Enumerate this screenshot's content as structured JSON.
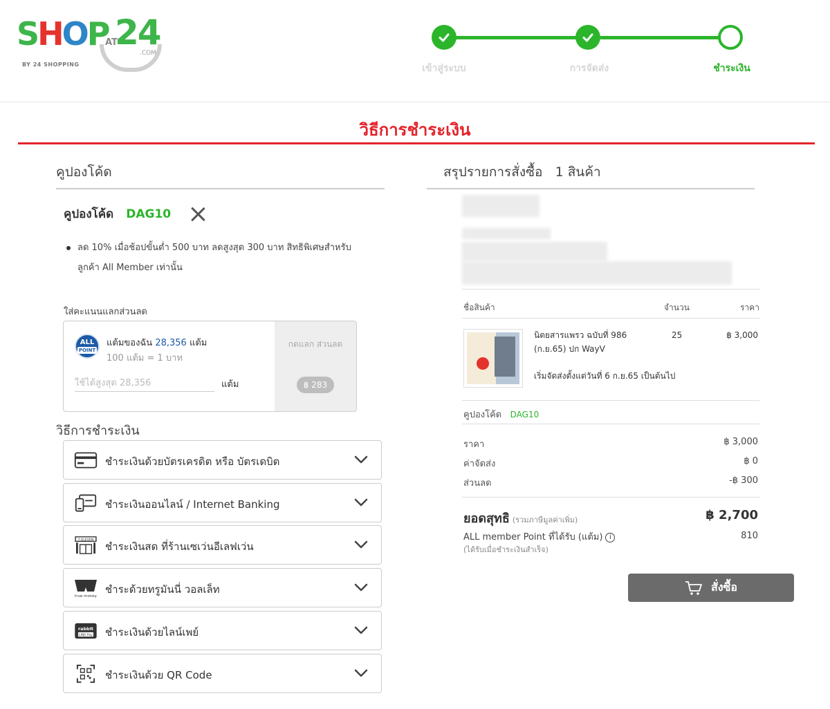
{
  "logo": {
    "shop": [
      "S",
      "H",
      "O",
      "P"
    ],
    "at": "AT",
    "num": "24",
    "com": ".COM",
    "tagline": "BY 24 SHOPPING"
  },
  "steps": [
    {
      "label": "เข้าสู่ระบบ",
      "done": true
    },
    {
      "label": "การจัดส่ง",
      "done": true
    },
    {
      "label": "ชำระเงิน",
      "done": false,
      "current": true
    }
  ],
  "page_title": "วิธีการชำระเงิน",
  "coupon": {
    "section_title": "คูปองโค้ด",
    "label": "คูปองโค้ด",
    "code": "DAG10",
    "description": "ลด 10% เมื่อช้อปขั้นต่ำ 500 บาท ลดสูงสุด 300 บาท สิทธิพิเศษสำหรับลูกค้า All Member เท่านั้น"
  },
  "points": {
    "title": "ใส่คะแนนแลกส่วนลด",
    "logo_top": "ALL",
    "logo_bottom": "POINT",
    "my_points_label": "แต้มของฉัน",
    "my_points_value": "28,356",
    "my_points_unit": "แต้ม",
    "rate": "100 แต้ม = 1 บาท",
    "input_placeholder": "ใช้ได้สูงสุด 28,356",
    "input_value": "",
    "input_unit": "แต้ม",
    "redeem_label": "กดแลก ส่วนลด",
    "redeem_amount": "฿ 283"
  },
  "payment": {
    "title": "วิธีการชำระเงิน",
    "options": [
      {
        "label": "ชำระเงินด้วยบัตรเครดิต หรือ บัตรเดบิต",
        "icon": "credit-card-icon"
      },
      {
        "label": "ชำระเงินออนไลน์ / Internet Banking",
        "icon": "online-banking-icon"
      },
      {
        "label": "ชำระเงินสด ที่ร้านเซเว่นอีเลฟเว่น",
        "icon": "seven-eleven-icon",
        "icon_text": "7-ELEVEN"
      },
      {
        "label": "ชำระด้วยทรูมันนี่ วอลเล็ท",
        "icon": "truemoney-icon",
        "icon_text": "true money"
      },
      {
        "label": "ชำระเงินด้วยไลน์เพย์",
        "icon": "linepay-icon",
        "icon_text": "rabbit LINE Pay"
      },
      {
        "label": "ชำระเงินด้วย QR Code",
        "icon": "qr-code-icon"
      }
    ]
  },
  "summary": {
    "title": "สรุปรายการสั่งซื้อ",
    "count": "1 สินค้า",
    "col_name": "ชื่อสินค้า",
    "col_qty": "จำนวน",
    "col_price": "ราคา",
    "item": {
      "name": "นิตยสารแพรว ฉบับที่ 986 (ก.ย.65) ปก WayV",
      "qty": "25",
      "price": "฿ 3,000",
      "note": "เริ่มจัดส่งตั้งแต่วันที่ 6 ก.ย.65 เป็นต้นไป"
    },
    "coupon_label": "คูปองโค้ด",
    "coupon_code": "DAG10",
    "price_label": "ราคา",
    "price_value": "฿ 3,000",
    "shipping_label": "ค่าจัดส่ง",
    "shipping_value": "฿ 0",
    "discount_label": "ส่วนลด",
    "discount_value": "-฿ 300",
    "net_label": "ยอดสุทธิ",
    "net_sub": "(รวมภาษีมูลค่าเพิ่ม)",
    "net_value": "฿ 2,700",
    "points_label": "ALL member Point ที่ได้รับ (แต้ม)",
    "points_sub": "(ได้รับเมื่อชำระเงินสำเร็จ)",
    "points_value": "810",
    "buy_label": "สั่งซื้อ"
  },
  "colors": {
    "brand_red": "#e4232b",
    "step_green": "#2bb52b",
    "button_gray": "#6b6b6b",
    "points_blue": "#1c5aa6"
  }
}
